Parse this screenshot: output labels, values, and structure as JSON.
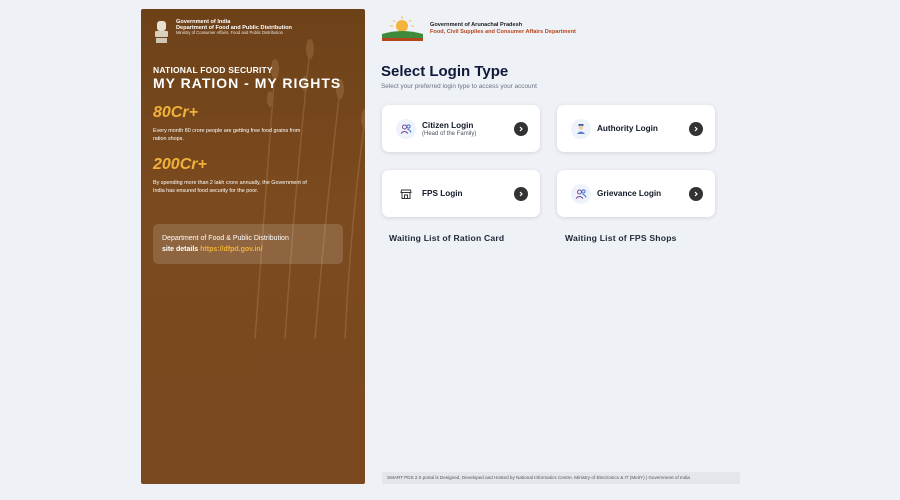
{
  "left_panel": {
    "gov_line1": "Government of India",
    "gov_line2": "Department of Food and Public Distribution",
    "gov_line3": "Ministry of Consumer Affairs, Food and Public Distribution",
    "nfs_heading": "NATIONAL FOOD SECURITY",
    "tagline": "MY RATION - MY RIGHTS",
    "stats": [
      {
        "value": "80Cr+",
        "description": "Every month 80 crore people are getting free food grains from ration shops."
      },
      {
        "value": "200Cr+",
        "description": "By spending more than 2 lakh crore annually, the Government of India has ensured food security for the poor."
      }
    ],
    "dept_box": {
      "line1": "Department of Food & Public Distribution",
      "label": "site details",
      "link": "https://dfpd.gov.in/"
    }
  },
  "header": {
    "state_line1": "Government of Arunachal Pradesh",
    "state_line2": "Food, Civil Supplies and Consumer Affairs Department"
  },
  "main": {
    "title": "Select Login Type",
    "subtitle": "Select your preferred login type to access your account",
    "cards": [
      {
        "label": "Citizen Login",
        "sub": "(Head of the Family)",
        "icon": "users-icon"
      },
      {
        "label": "Authority Login",
        "sub": "",
        "icon": "officer-icon"
      },
      {
        "label": "FPS Login",
        "sub": "",
        "icon": "shop-icon"
      },
      {
        "label": "Grievance Login",
        "sub": "",
        "icon": "users-icon"
      }
    ],
    "waiting_lists": [
      "Waiting List of Ration Card",
      "Waiting List of FPS Shops"
    ]
  },
  "footer": {
    "text": "SMART PDS 2.0 portal is Designed, Developed and Hosted by National Informatics Centre, Ministry of Electronics & IT (MeitY) | Government of India"
  },
  "colors": {
    "panel_brown": "#7b4a1e",
    "stat_gold": "#f0b23a",
    "title_navy": "#0f1a3b",
    "arrow_dark": "#333333"
  }
}
